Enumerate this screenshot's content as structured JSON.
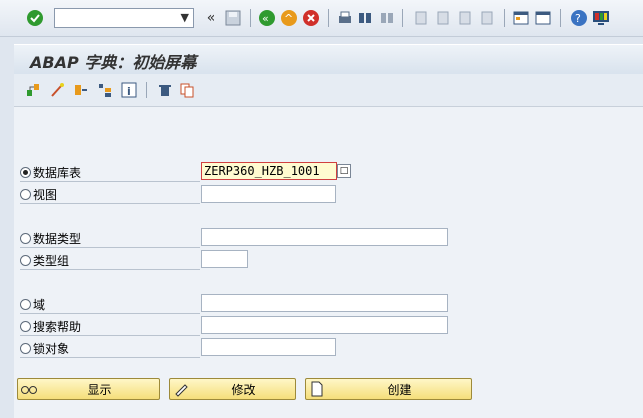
{
  "toolbar": {
    "command_field_value": "",
    "icons": [
      "enter-icon",
      "dropdown-icon",
      "back-double-icon",
      "save-icon",
      "back-icon",
      "exit-icon",
      "cancel-icon",
      "print-icon",
      "find-icon",
      "find-next-icon",
      "first-page-icon",
      "prev-page-icon",
      "next-page-icon",
      "last-page-icon",
      "new-session-icon",
      "shortcut-icon",
      "help-icon",
      "customize-layout-icon"
    ]
  },
  "title": "ABAP 字典：初始屏幕",
  "app_toolbar": {
    "icons": [
      "other-object-icon",
      "check-icon",
      "activate-icon",
      "where-used-icon",
      "info-icon",
      "delete-icon",
      "copy-icon"
    ]
  },
  "form": {
    "options": [
      {
        "label": "数据库表",
        "selected": true,
        "value": "ZERP360_HZB_1001"
      },
      {
        "label": "视图",
        "selected": false,
        "value": ""
      },
      {
        "label": "数据类型",
        "selected": false,
        "value": ""
      },
      {
        "label": "类型组",
        "selected": false,
        "value": ""
      },
      {
        "label": "域",
        "selected": false,
        "value": ""
      },
      {
        "label": "搜索帮助",
        "selected": false,
        "value": ""
      },
      {
        "label": "锁对象",
        "selected": false,
        "value": ""
      }
    ],
    "value_help_icon": "□"
  },
  "buttons": {
    "display": "显示",
    "change": "修改",
    "create": "创建"
  },
  "colors": {
    "background": "#dfe6ef",
    "button": "#f5de7a",
    "active_field": "#fffbd0",
    "green": "#2f9a2f",
    "red": "#d0302a",
    "orange": "#e89a1b"
  }
}
